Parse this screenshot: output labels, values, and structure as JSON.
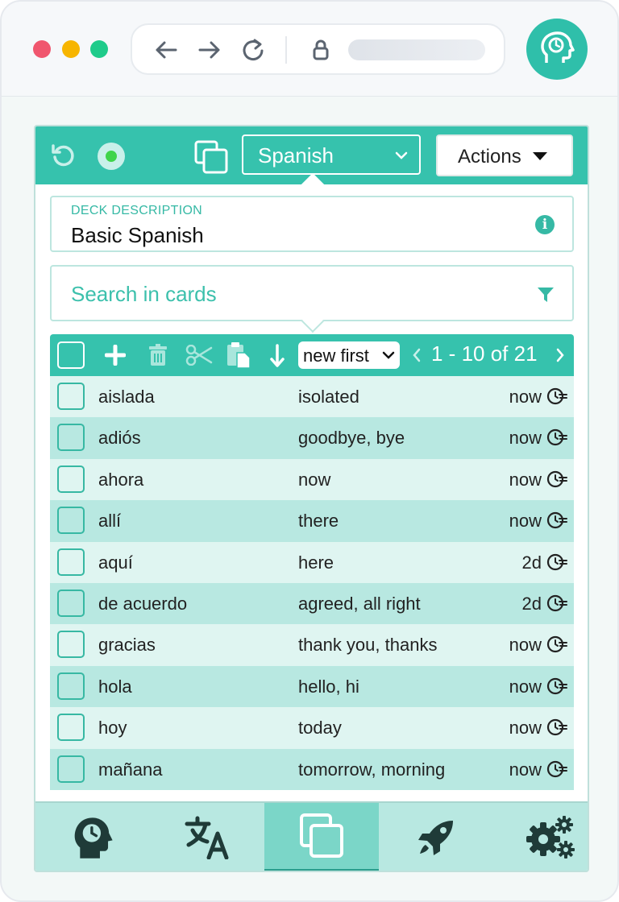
{
  "browser": {
    "traffic_lights": [
      "#f0566e",
      "#f7b500",
      "#1fcb8a"
    ],
    "icons": [
      "back-icon",
      "forward-icon",
      "reload-icon",
      "lock-icon"
    ],
    "extension_icon": "head-clock-icon"
  },
  "header": {
    "deck_selected": "Spanish",
    "actions_label": "Actions",
    "icons": [
      "undo-icon",
      "status-dot-icon",
      "copy-cards-icon"
    ]
  },
  "deck_description": {
    "label": "DECK DESCRIPTION",
    "value": "Basic Spanish"
  },
  "search": {
    "placeholder": "Search in cards"
  },
  "toolbar": {
    "sort_value": "new first",
    "pager_text": "1 - 10 of 21"
  },
  "cards": [
    {
      "front": "aislada",
      "back": "isolated",
      "due": "now"
    },
    {
      "front": "adiós",
      "back": "goodbye, bye",
      "due": "now"
    },
    {
      "front": "ahora",
      "back": "now",
      "due": "now"
    },
    {
      "front": "allí",
      "back": "there",
      "due": "now"
    },
    {
      "front": "aquí",
      "back": "here",
      "due": "2d"
    },
    {
      "front": "de acuerdo",
      "back": "agreed, all right",
      "due": "2d"
    },
    {
      "front": "gracias",
      "back": "thank you, thanks",
      "due": "now"
    },
    {
      "front": "hola",
      "back": "hello, hi",
      "due": "now"
    },
    {
      "front": "hoy",
      "back": "today",
      "due": "now"
    },
    {
      "front": "mañana",
      "back": "tomorrow, morning",
      "due": "now"
    }
  ],
  "bottom_nav": [
    "review-icon",
    "translate-icon",
    "cards-icon",
    "rocket-icon",
    "settings-icon"
  ],
  "colors": {
    "accent": "#36c2ad",
    "row_light": "#dff5f1",
    "row_dark": "#b8e8e1",
    "nav_active": "#7bd6c8"
  }
}
